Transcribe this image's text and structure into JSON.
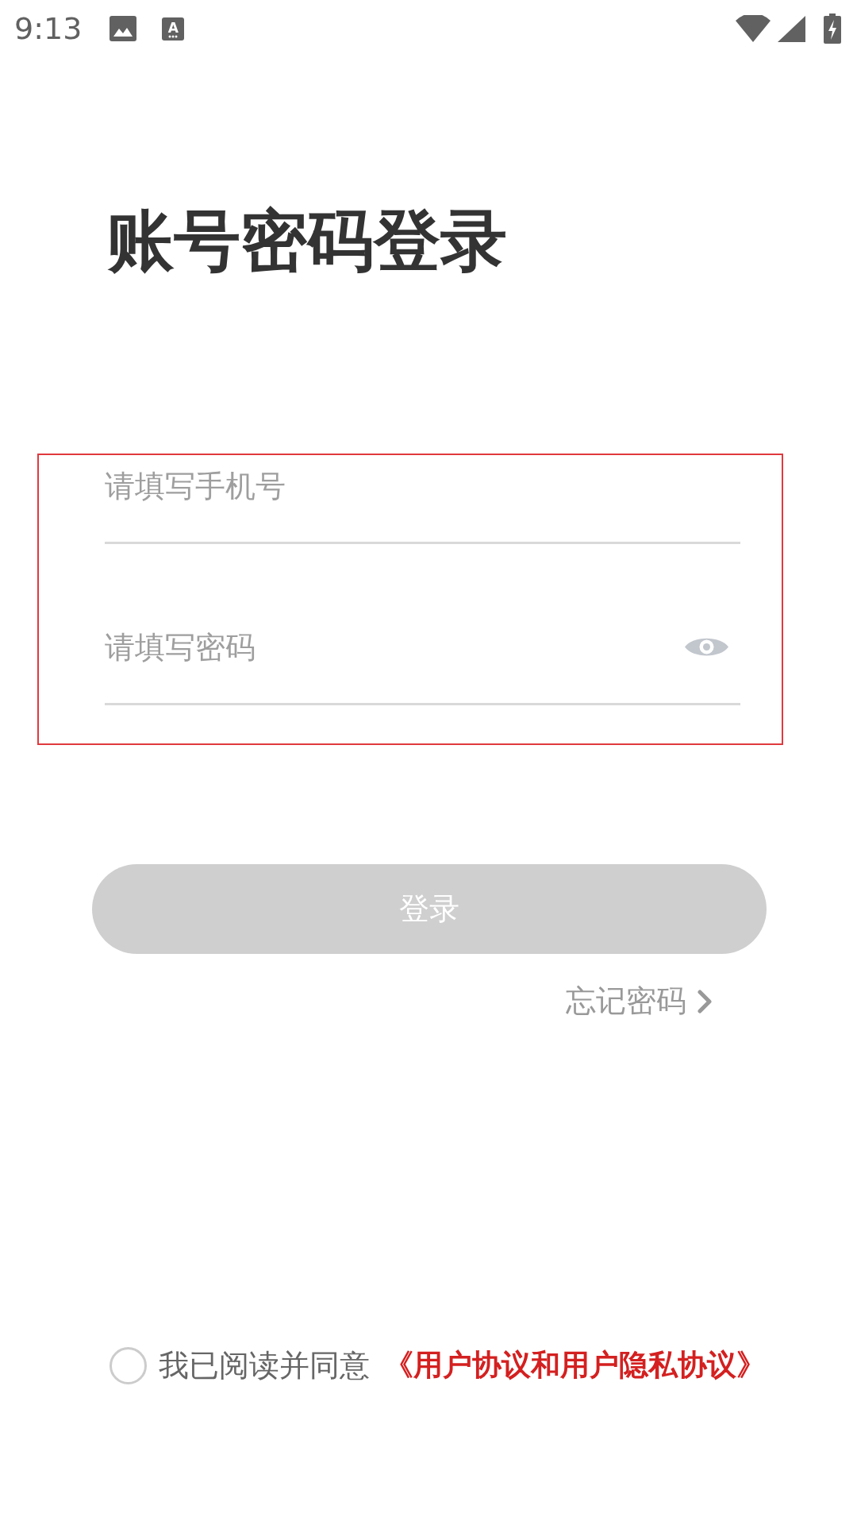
{
  "status_bar": {
    "time": "9:13",
    "notification_letter": "A"
  },
  "title": "账号密码登录",
  "form": {
    "highlighted": true,
    "fields": [
      {
        "kind": "phone",
        "placeholder": "请填写手机号"
      },
      {
        "kind": "password",
        "placeholder": "请填写密码"
      }
    ]
  },
  "login_button": {
    "label": "登录",
    "disabled": true
  },
  "forgot_password": {
    "label": "忘记密码"
  },
  "agreement": {
    "checked": false,
    "text": "我已阅读并同意",
    "link": "《用户协议和用户隐私协议》"
  }
}
